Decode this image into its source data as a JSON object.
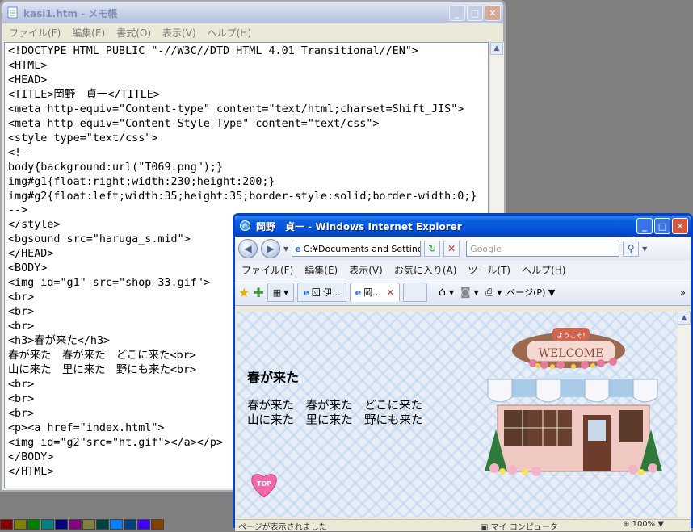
{
  "notepad": {
    "title": "kasi1.htm - メモ帳",
    "menu": [
      "ファイル(F)",
      "編集(E)",
      "書式(O)",
      "表示(V)",
      "ヘルプ(H)"
    ],
    "content": "<!DOCTYPE HTML PUBLIC \"-//W3C//DTD HTML 4.01 Transitional//EN\">\n<HTML>\n<HEAD>\n<TITLE>岡野　貞一</TITLE>\n<meta http-equiv=\"Content-type\" content=\"text/html;charset=Shift_JIS\">\n<meta http-equiv=\"Content-Style-Type\" content=\"text/css\">\n<style type=\"text/css\">\n<!--\nbody{background:url(\"T069.png\");}\nimg#g1{float:right;width:230;height:200;}\nimg#g2{float:left;width:35;height:35;border-style:solid;border-width:0;}\n-->\n</style>\n<bgsound src=\"haruga_s.mid\">\n</HEAD>\n<BODY>\n<img id=\"g1\" src=\"shop-33.gif\">\n<br>\n<br>\n<br>\n<h3>春が来た</h3>\n春が来た　春が来た　どこに来た<br>\n山に来た　里に来た　野にも来た<br>\n<br>\n<br>\n<br>\n<p><a href=\"index.html\">\n<img id=\"g2\"src=\"ht.gif\"></a></p>\n</BODY>\n</HTML>"
  },
  "ie": {
    "title": "岡野　貞一 - Windows Internet Explorer",
    "address": "C:¥Documents and Settings",
    "search_placeholder": "Google",
    "menu": [
      "ファイル(F)",
      "編集(E)",
      "表示(V)",
      "お気に入り(A)",
      "ツール(T)",
      "ヘルプ(H)"
    ],
    "tabs": [
      "団 伊...",
      "岡..."
    ],
    "page_menu": "ページ(P)",
    "page": {
      "heading": "春が来た",
      "line1": "春が来た　春が来た　どこに来た",
      "line2": "山に来た　里に来た　野にも来た",
      "welcome_sign": "ようこそ!",
      "welcome_text": "WELCOME",
      "top_button": "TOP"
    },
    "status_left": "ページが表示されました",
    "status_zone": "マイ コンピュータ",
    "zoom": "100%"
  },
  "palette_colors": [
    "#800000",
    "#808000",
    "#008000",
    "#008080",
    "#000080",
    "#800080",
    "#808040",
    "#004040",
    "#0080ff",
    "#004080",
    "#4000ff",
    "#804000"
  ]
}
